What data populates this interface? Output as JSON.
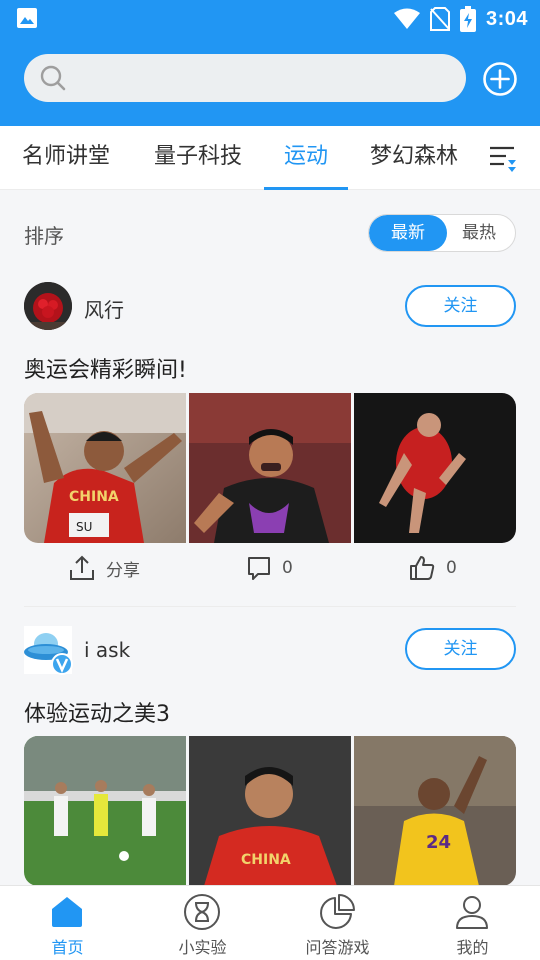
{
  "status_bar": {
    "time": "3:04"
  },
  "search": {
    "placeholder": "",
    "value": ""
  },
  "tabs": [
    {
      "label": "名师讲堂",
      "active": false
    },
    {
      "label": "量子科技",
      "active": false
    },
    {
      "label": "运动",
      "active": true
    },
    {
      "label": "梦幻森林",
      "active": false
    }
  ],
  "sort": {
    "label": "排序",
    "options": [
      "最新",
      "最热"
    ],
    "selected": "最新"
  },
  "posts": [
    {
      "author": "风行",
      "follow_label": "关注",
      "title": "奥运会精彩瞬间!",
      "images": [
        "sprinter-photo",
        "table-tennis-photo",
        "diver-photo"
      ],
      "share_label": "分享",
      "comments": "0",
      "likes": "0"
    },
    {
      "author": "i ask",
      "follow_label": "关注",
      "title": "体验运动之美3",
      "images": [
        "youth-soccer-photo",
        "athlete-portrait-photo",
        "basketball-photo"
      ]
    }
  ],
  "bottom_nav": [
    {
      "label": "首页",
      "icon": "home-icon",
      "active": true
    },
    {
      "label": "小实验",
      "icon": "hourglass-icon",
      "active": false
    },
    {
      "label": "问答游戏",
      "icon": "pie-chart-icon",
      "active": false
    },
    {
      "label": "我的",
      "icon": "user-icon",
      "active": false
    }
  ],
  "colors": {
    "primary": "#2196f3",
    "background": "#f5f6f8"
  }
}
